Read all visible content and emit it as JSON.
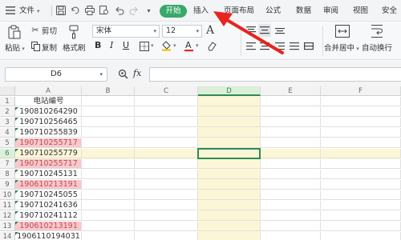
{
  "menubar": {
    "file_label": "文件",
    "tabs": [
      {
        "label": "开始",
        "active": true
      },
      {
        "label": "插入"
      },
      {
        "label": "页面布局"
      },
      {
        "label": "公式"
      },
      {
        "label": "数据"
      },
      {
        "label": "审阅"
      },
      {
        "label": "视图"
      },
      {
        "label": "安全"
      }
    ]
  },
  "ribbon": {
    "cut": "剪切",
    "paste": "粘贴",
    "copy": "复制",
    "format_painter": "格式刷",
    "font_name": "宋体",
    "font_size": "12",
    "merge_center": "合并居中",
    "wrap_text": "自动换行"
  },
  "formula_bar": {
    "cell_ref": "D6",
    "fx": "fx",
    "formula": ""
  },
  "sheet": {
    "columns": [
      "A",
      "B",
      "C",
      "D",
      "E",
      "F"
    ],
    "rows": [
      {
        "n": "1",
        "a": "电站编号",
        "hl": false
      },
      {
        "n": "2",
        "a": "190810264290",
        "hl": false
      },
      {
        "n": "3",
        "a": "190710256465",
        "hl": false
      },
      {
        "n": "4",
        "a": "190710255839",
        "hl": false
      },
      {
        "n": "5",
        "a": "190710255717",
        "hl": true
      },
      {
        "n": "6",
        "a": "190710255779",
        "hl": false
      },
      {
        "n": "7",
        "a": "190710255717",
        "hl": true
      },
      {
        "n": "8",
        "a": "190710245131",
        "hl": false
      },
      {
        "n": "9",
        "a": "190610213191",
        "hl": true
      },
      {
        "n": "10",
        "a": "190710245055",
        "hl": false
      },
      {
        "n": "11",
        "a": "190710241636",
        "hl": false
      },
      {
        "n": "12",
        "a": "190710241112",
        "hl": false
      },
      {
        "n": "13",
        "a": "190610213191",
        "hl": true
      },
      {
        "n": "14",
        "a": "1906110194031",
        "hl": false
      }
    ],
    "selected_cell": "D6"
  },
  "colors": {
    "accent_green": "#39a96b",
    "duplicate_fill": "#f9c7ce",
    "duplicate_text": "#c0504d",
    "selection_tint": "#fbf7d6",
    "arrow_red": "#e8241e"
  }
}
